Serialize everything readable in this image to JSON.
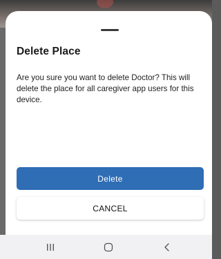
{
  "dialog": {
    "title": "Delete Place",
    "message": "Are you sure you want to delete Doctor? This will delete the place for all caregiver app users for this device.",
    "delete_label": "Delete",
    "cancel_label": "CANCEL"
  },
  "navbar": {
    "recents_icon": "recents-icon",
    "home_icon": "home-icon",
    "back_icon": "back-icon"
  },
  "colors": {
    "primary": "#2f6db5",
    "sheet_background": "#ffffff",
    "navbar_background": "#f1f1f3"
  }
}
